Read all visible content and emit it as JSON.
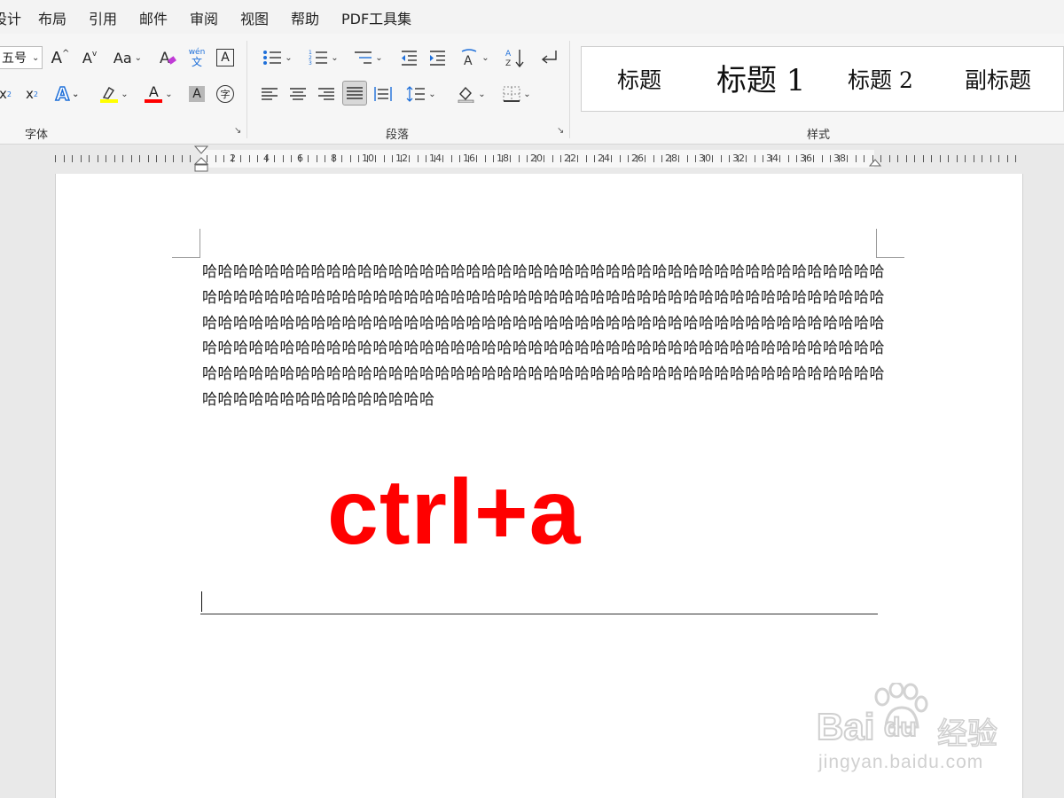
{
  "menu": {
    "items": [
      "设计",
      "布局",
      "引用",
      "邮件",
      "审阅",
      "视图",
      "帮助",
      "PDF工具集"
    ]
  },
  "ribbon": {
    "font_group": {
      "label": "字体",
      "font_size": "五号",
      "grow_font": "A",
      "shrink_font": "A",
      "change_case": "Aa",
      "phonetic_top": "wén",
      "phonetic_bottom": "文",
      "char_border": "A",
      "subscript": "x",
      "subscript_mark": "2",
      "superscript": "x",
      "superscript_mark": "2",
      "text_effect": "A",
      "font_color": "A",
      "char_shading": "A",
      "enclose_char": "字"
    },
    "paragraph_group": {
      "label": "段落"
    },
    "styles_group": {
      "label": "样式",
      "items": [
        {
          "label": "标题"
        },
        {
          "label": "标题 1"
        },
        {
          "label": "标题 2"
        },
        {
          "label": "副标题"
        }
      ]
    }
  },
  "ruler": {
    "numbers": [
      "2",
      "4",
      "6",
      "8",
      "10",
      "12",
      "14",
      "16",
      "18",
      "20",
      "22",
      "24",
      "26",
      "28",
      "30",
      "32",
      "34",
      "36",
      "38"
    ]
  },
  "document": {
    "body_text": "哈哈哈哈哈哈哈哈哈哈哈哈哈哈哈哈哈哈哈哈哈哈哈哈哈哈哈哈哈哈哈哈哈哈哈哈哈哈哈哈哈哈哈哈哈哈哈哈哈哈哈哈哈哈哈哈哈哈哈哈哈哈哈哈哈哈哈哈哈哈哈哈哈哈哈哈哈哈哈哈哈哈哈哈哈哈哈哈哈哈哈哈哈哈哈哈哈哈哈哈哈哈哈哈哈哈哈哈哈哈哈哈哈哈哈哈哈哈哈哈哈哈哈哈哈哈哈哈哈哈哈哈哈哈哈哈哈哈哈哈哈哈哈哈哈哈哈哈哈哈哈哈哈哈哈哈哈哈哈哈哈哈哈哈哈哈哈哈哈哈哈哈哈哈哈哈哈哈哈哈哈哈哈哈哈哈哈哈哈哈哈哈哈哈哈哈哈哈哈哈哈哈哈哈哈哈哈哈哈哈哈哈哈哈哈哈哈哈哈哈哈哈哈哈哈哈哈哈哈哈哈哈哈哈哈",
    "hotkey_overlay": "ctrl+a"
  },
  "watermark": {
    "brand": "Bai",
    "brand2": "du",
    "cn": "经验",
    "url": "jingyan.baidu.com"
  },
  "colors": {
    "highlight": "#ffff00",
    "font_color": "#ff0000",
    "text_effect": "#1e6fd9",
    "overlay_text": "#ff0000"
  }
}
